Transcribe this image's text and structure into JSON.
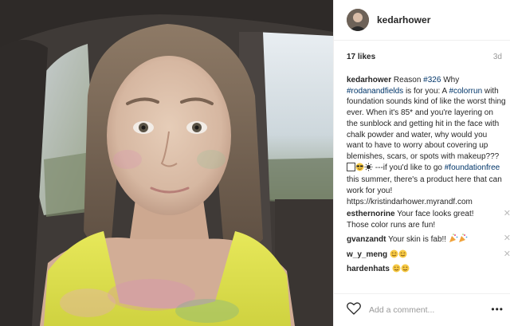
{
  "post": {
    "username": "kedarhower",
    "likes": "17 likes",
    "age": "3d",
    "image_description_icon": "selfie-photo"
  },
  "caption": {
    "user": "kedarhower",
    "text_1": "Reason ",
    "tag_1": "#326",
    "text_2": " Why ",
    "tag_2": "#rodanandfields",
    "text_3": " is for you: A ",
    "tag_3": "#colorrun",
    "text_4": " with foundation sounds kind of like the worst thing ever. When it's 85* and you're layering on the sunblock and getting hit in the face with chalk powder and water, why would you want to have to worry about covering up blemishes, scars, or spots with makeup???",
    "text_5": " ---if you'd like to go ",
    "tag_4": "#foundationfree",
    "text_6": " this summer, there's a product here that can work for you! https://kristindarhower.myrandf.com"
  },
  "comments": [
    {
      "user": "esthernorine",
      "text": "Your face looks great! Those color runs are fun!"
    },
    {
      "user": "gvanzandt",
      "text": "Your skin is fab!!"
    },
    {
      "user": "w_y_meng",
      "text": ""
    },
    {
      "user": "hardenhats",
      "text": ""
    }
  ],
  "footer": {
    "placeholder": "Add a comment...",
    "more_label": "•••"
  },
  "colors": {
    "hashtag": "#003569",
    "text": "#262626",
    "muted": "#999999",
    "border": "#efefef"
  }
}
